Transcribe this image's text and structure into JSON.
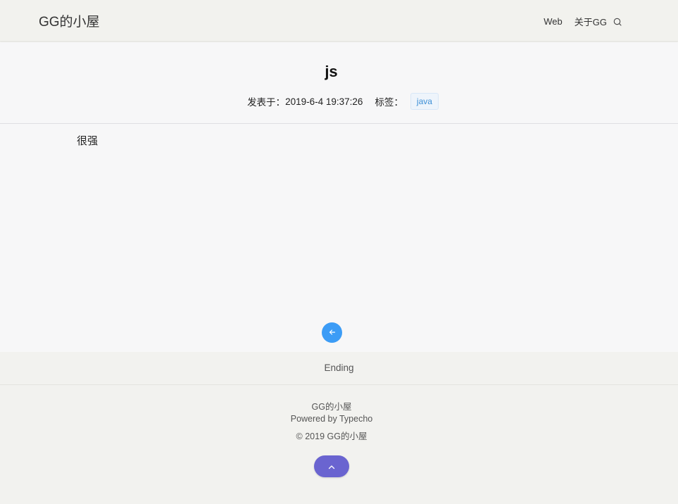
{
  "header": {
    "site_title": "GG的小屋",
    "nav": [
      {
        "label": "Web"
      },
      {
        "label": "关于GG"
      }
    ],
    "search_icon": "search-icon"
  },
  "post": {
    "title": "js",
    "published_label": "发表于：",
    "published_date": "2019-6-4 19:37:26",
    "tags_label": "标签：",
    "tags": [
      "java"
    ],
    "content": "很强",
    "back_icon": "arrow-left-icon"
  },
  "footer": {
    "ending": "Ending",
    "site_name": "GG的小屋",
    "powered_by": "Powered by Typecho",
    "copyright": "© 2019 GG的小屋",
    "top_icon": "chevron-up-icon"
  },
  "colors": {
    "accent_blue": "#3c9cf6",
    "tag_text": "#3d8fd6",
    "top_button": "#6a64d0",
    "header_bg": "#f2f2ee",
    "content_bg": "#f7f7f8"
  }
}
